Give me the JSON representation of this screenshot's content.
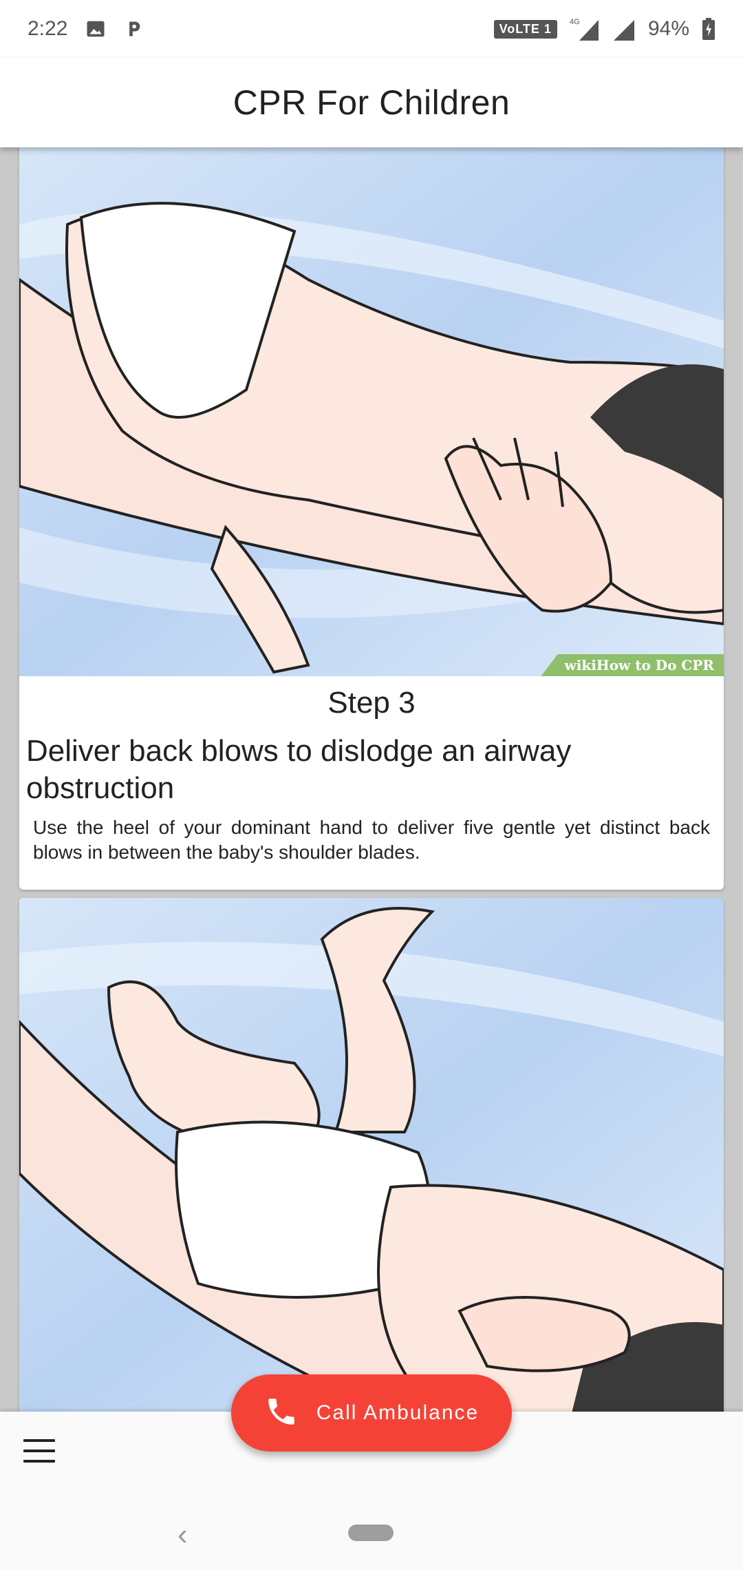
{
  "status_bar": {
    "time": "2:22",
    "volte": "VoLTE 1",
    "network": "4G",
    "battery": "94%"
  },
  "app_bar": {
    "title": "CPR For Children"
  },
  "cards": [
    {
      "step_label": "Step 3",
      "title": "Deliver back blows to dislodge an airway obstruction",
      "description": "Use the heel of your dominant hand to deliver five gentle yet distinct back blows in between the baby's shoulder blades.",
      "watermark": "wikiHow to Do CPR"
    }
  ],
  "fab": {
    "label": "Call Ambulance"
  },
  "colors": {
    "accent": "#f44336",
    "sky": "#c8dcf5",
    "skin": "#fde6dc"
  },
  "icons": [
    "image-icon",
    "parking-icon",
    "signal-icon",
    "battery-icon",
    "phone-icon",
    "menu-icon",
    "back-icon"
  ]
}
